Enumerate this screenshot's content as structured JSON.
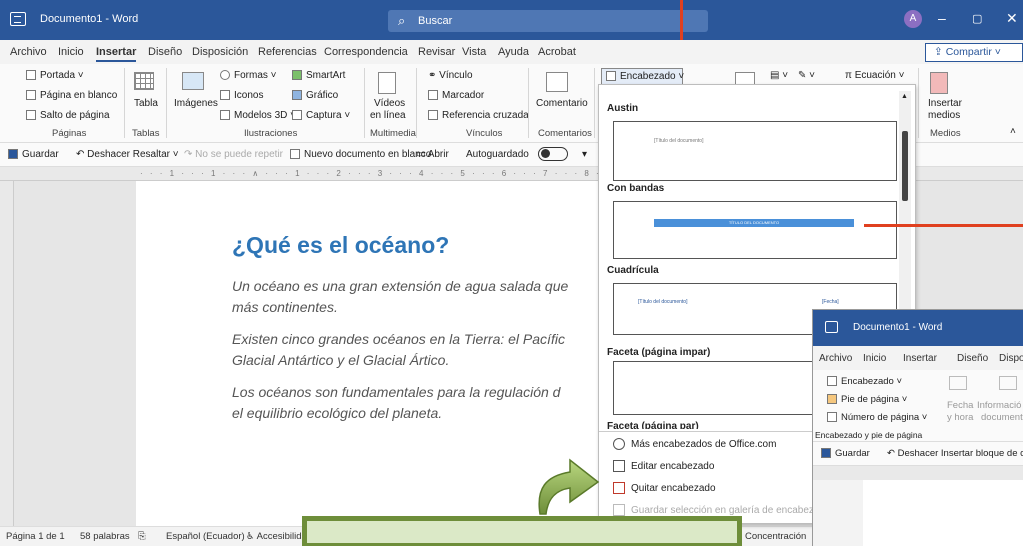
{
  "window": {
    "title": "Documento1 - Word",
    "search_placeholder": "Buscar",
    "avatar_initial": "A"
  },
  "menu_tabs": [
    "Archivo",
    "Inicio",
    "Insertar",
    "Diseño",
    "Disposición",
    "Referencias",
    "Correspondencia",
    "Revisar",
    "Vista",
    "Ayuda",
    "Acrobat"
  ],
  "share_label": "Compartir",
  "ribbon": {
    "paginas": {
      "portada": "Portada",
      "pagina_blanco": "Página en blanco",
      "salto": "Salto de página",
      "label": "Páginas"
    },
    "tablas": {
      "tabla": "Tabla",
      "label": "Tablas"
    },
    "ilustraciones": {
      "imagenes": "Imágenes",
      "formas": "Formas",
      "iconos": "Iconos",
      "modelos": "Modelos 3D",
      "smartart": "SmartArt",
      "grafico": "Gráfico",
      "captura": "Captura",
      "label": "Ilustraciones"
    },
    "multimedia": {
      "videos": "Vídeos",
      "en_linea": "en línea",
      "label": "Multimedia"
    },
    "vinculos": {
      "vinculo": "Vínculo",
      "marcador": "Marcador",
      "referencia": "Referencia cruzada",
      "label": "Vínculos"
    },
    "comentarios": {
      "comentario": "Comentario",
      "label": "Comentarios"
    },
    "encabezado_btn": "Encabezado",
    "ecuacion": "Ecuación",
    "medios": {
      "insertar": "Insertar",
      "medios": "medios",
      "label": "Medios"
    }
  },
  "qat": {
    "guardar": "Guardar",
    "deshacer": "Deshacer Resaltar",
    "repetir": "No se puede repetir",
    "nuevo": "Nuevo documento en blanco",
    "abrir": "Abrir",
    "autoguardado": "Autoguardado"
  },
  "document": {
    "title": "¿Qué es el océano?",
    "paragraphs": [
      [
        "Un océano es una gran extensión de agua salada que",
        "más continentes."
      ],
      [
        "Existen cinco grandes océanos en la Tierra: el Pacífic",
        "Glacial Antártico y el Glacial Ártico."
      ],
      [
        "Los océanos son fundamentales para la regulación d",
        "el equilibrio ecológico del planeta."
      ]
    ]
  },
  "gallery": {
    "sections": [
      "Austin",
      "Con bandas",
      "Cuadrícula",
      "Faceta (página impar)",
      "Faceta (página par)"
    ],
    "austin_thumb": "[Título del documento]",
    "bandas_thumb": "TÍTULO DEL DOCUMENTO",
    "cuadricula_left": "[Título del documento]",
    "cuadricula_right": "[Fecha]",
    "menu": [
      {
        "label": "Más encabezados de Office.com",
        "enabled": true
      },
      {
        "label": "Editar encabezado",
        "enabled": true
      },
      {
        "label": "Quitar encabezado",
        "enabled": true
      },
      {
        "label": "Guardar selección en galería de encabezados...",
        "enabled": false
      }
    ]
  },
  "status": {
    "pagina": "Página 1 de 1",
    "palabras": "58 palabras",
    "idioma": "Español (Ecuador)",
    "accesibilidad": "Accesibilid",
    "concentracion": "Concentración"
  },
  "inset": {
    "title": "Documento1 - Word",
    "menu": [
      "Archivo",
      "Inicio",
      "Insertar",
      "Diseño",
      "Dispos"
    ],
    "encabezado": "Encabezado",
    "pie": "Pie de página",
    "numero": "Número de página",
    "fecha": "Fecha",
    "y_hora": "y hora",
    "informacion": "Informació",
    "documento": "document",
    "group_label": "Encabezado y pie de página",
    "guardar": "Guardar",
    "deshacer": "Deshacer Insertar bloque de crea"
  },
  "colors": {
    "word_blue": "#2b579a",
    "annotation_red": "#e0401f",
    "callout_green": "#6e8e3a",
    "title_blue": "#2e75b6"
  }
}
